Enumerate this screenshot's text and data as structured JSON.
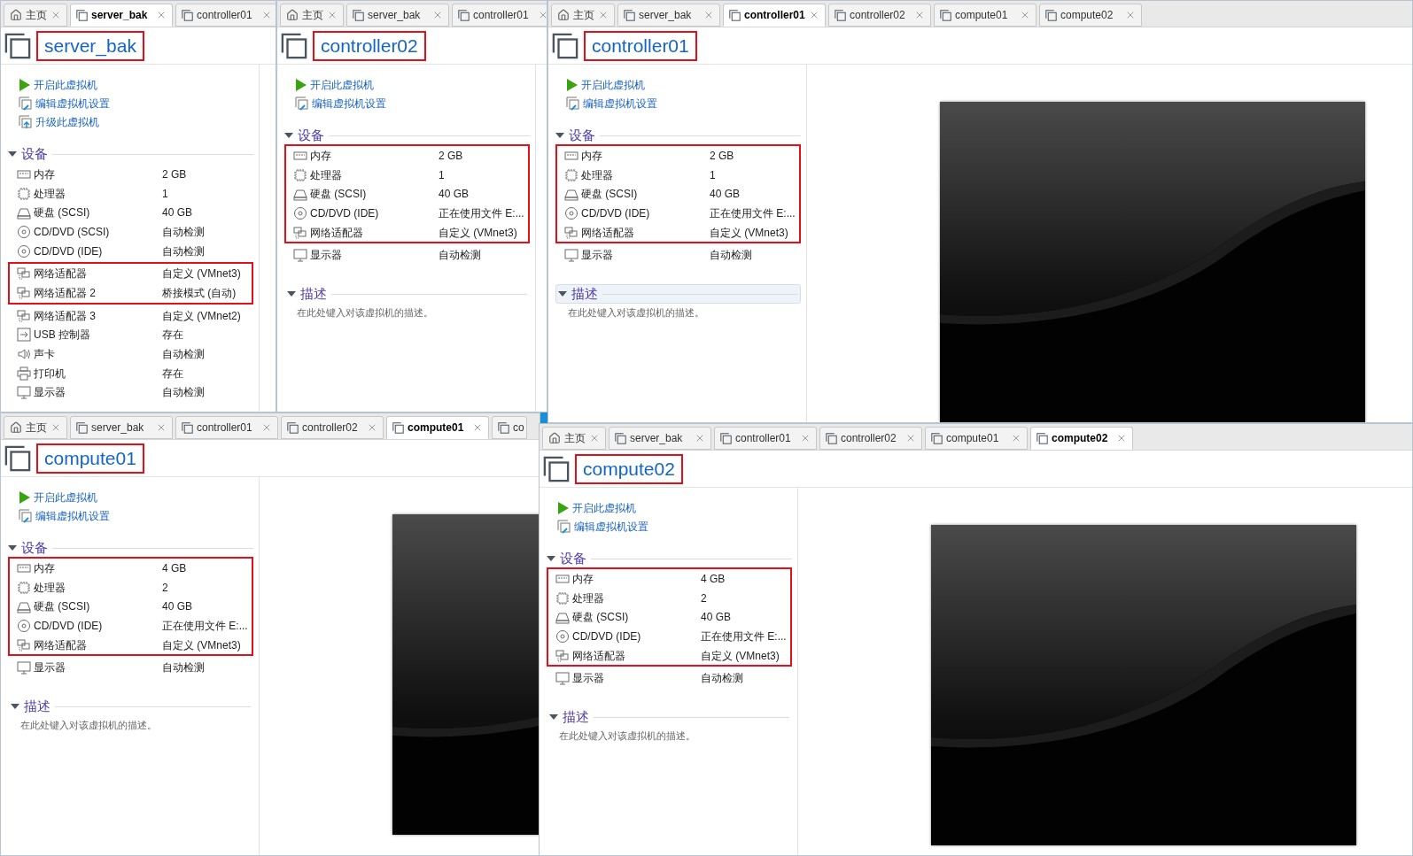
{
  "windows": [
    {
      "tabs": [
        {
          "label": "主页",
          "kind": "home",
          "selected": false
        },
        {
          "label": "server_bak",
          "kind": "vm",
          "selected": true
        },
        {
          "label": "controller01",
          "kind": "vm",
          "selected": false
        }
      ],
      "title": "server_bak",
      "title_highlighted": true,
      "actions": [
        {
          "label": "开启此虚拟机",
          "kind": "power"
        },
        {
          "label": "编辑虚拟机设置",
          "kind": "edit"
        },
        {
          "label": "升级此虚拟机",
          "kind": "upgrade"
        }
      ],
      "devices_header": "设备",
      "devices": [
        {
          "kind": "memory",
          "label": "内存",
          "value": "2 GB",
          "highlighted": false
        },
        {
          "kind": "cpu",
          "label": "处理器",
          "value": "1",
          "highlighted": false
        },
        {
          "kind": "disk",
          "label": "硬盘 (SCSI)",
          "value": "40 GB",
          "highlighted": false
        },
        {
          "kind": "cdrom",
          "label": "CD/DVD (SCSI)",
          "value": "自动检测",
          "highlighted": false
        },
        {
          "kind": "cdrom",
          "label": "CD/DVD (IDE)",
          "value": "自动检测",
          "highlighted": false
        },
        {
          "kind": "network",
          "label": "网络适配器",
          "value": "自定义 (VMnet3)",
          "highlighted": true
        },
        {
          "kind": "network",
          "label": "网络适配器 2",
          "value": "桥接模式 (自动)",
          "highlighted": true
        },
        {
          "kind": "network",
          "label": "网络适配器 3",
          "value": "自定义 (VMnet2)",
          "highlighted": false
        },
        {
          "kind": "usb",
          "label": "USB 控制器",
          "value": "存在",
          "highlighted": false
        },
        {
          "kind": "sound",
          "label": "声卡",
          "value": "自动检测",
          "highlighted": false
        },
        {
          "kind": "printer",
          "label": "打印机",
          "value": "存在",
          "highlighted": false
        },
        {
          "kind": "display",
          "label": "显示器",
          "value": "自动检测",
          "highlighted": false
        }
      ]
    },
    {
      "tabs": [
        {
          "label": "主页",
          "kind": "home",
          "selected": false
        },
        {
          "label": "server_bak",
          "kind": "vm",
          "selected": false
        },
        {
          "label": "controller01",
          "kind": "vm",
          "selected": false
        }
      ],
      "title": "controller02",
      "title_highlighted": true,
      "actions": [
        {
          "label": "开启此虚拟机",
          "kind": "power"
        },
        {
          "label": "编辑虚拟机设置",
          "kind": "edit"
        }
      ],
      "devices_header": "设备",
      "devices": [
        {
          "kind": "memory",
          "label": "内存",
          "value": "2 GB",
          "highlighted": true
        },
        {
          "kind": "cpu",
          "label": "处理器",
          "value": "1",
          "highlighted": true
        },
        {
          "kind": "disk",
          "label": "硬盘 (SCSI)",
          "value": "40 GB",
          "highlighted": true
        },
        {
          "kind": "cdrom",
          "label": "CD/DVD (IDE)",
          "value": "正在使用文件 E:...",
          "highlighted": true
        },
        {
          "kind": "network",
          "label": "网络适配器",
          "value": "自定义 (VMnet3)",
          "highlighted": true
        },
        {
          "kind": "display",
          "label": "显示器",
          "value": "自动检测",
          "highlighted": false
        }
      ],
      "description": {
        "label": "描述",
        "text": "在此处键入对该虚拟机的描述。",
        "selected": false
      }
    },
    {
      "tabs": [
        {
          "label": "主页",
          "kind": "home",
          "selected": false
        },
        {
          "label": "server_bak",
          "kind": "vm",
          "selected": false
        },
        {
          "label": "controller01",
          "kind": "vm",
          "selected": true
        },
        {
          "label": "controller02",
          "kind": "vm",
          "selected": false
        },
        {
          "label": "compute01",
          "kind": "vm",
          "selected": false
        },
        {
          "label": "compute02",
          "kind": "vm",
          "selected": false
        }
      ],
      "title": "controller01",
      "title_highlighted": true,
      "actions": [
        {
          "label": "开启此虚拟机",
          "kind": "power"
        },
        {
          "label": "编辑虚拟机设置",
          "kind": "edit"
        }
      ],
      "devices_header": "设备",
      "devices": [
        {
          "kind": "memory",
          "label": "内存",
          "value": "2 GB",
          "highlighted": true
        },
        {
          "kind": "cpu",
          "label": "处理器",
          "value": "1",
          "highlighted": true
        },
        {
          "kind": "disk",
          "label": "硬盘 (SCSI)",
          "value": "40 GB",
          "highlighted": true
        },
        {
          "kind": "cdrom",
          "label": "CD/DVD (IDE)",
          "value": "正在使用文件 E:...",
          "highlighted": true
        },
        {
          "kind": "network",
          "label": "网络适配器",
          "value": "自定义 (VMnet3)",
          "highlighted": true
        },
        {
          "kind": "display",
          "label": "显示器",
          "value": "自动检测",
          "highlighted": false
        }
      ],
      "description": {
        "label": "描述",
        "text": "在此处键入对该虚拟机的描述。",
        "selected": true
      },
      "preview": {
        "kind": "picture"
      }
    },
    {
      "tabs": [
        {
          "label": "主页",
          "kind": "home",
          "selected": false
        },
        {
          "label": "server_bak",
          "kind": "vm",
          "selected": false
        },
        {
          "label": "controller01",
          "kind": "vm",
          "selected": false
        },
        {
          "label": "controller02",
          "kind": "vm",
          "selected": false
        },
        {
          "label": "compute01",
          "kind": "vm",
          "selected": true
        },
        {
          "label": "co",
          "kind": "vm",
          "selected": false,
          "close_visible": false
        }
      ],
      "title": "compute01",
      "title_highlighted": true,
      "actions": [
        {
          "label": "开启此虚拟机",
          "kind": "power"
        },
        {
          "label": "编辑虚拟机设置",
          "kind": "edit"
        }
      ],
      "devices_header": "设备",
      "devices": [
        {
          "kind": "memory",
          "label": "内存",
          "value": "4 GB",
          "highlighted": true
        },
        {
          "kind": "cpu",
          "label": "处理器",
          "value": "2",
          "highlighted": true
        },
        {
          "kind": "disk",
          "label": "硬盘 (SCSI)",
          "value": "40 GB",
          "highlighted": true
        },
        {
          "kind": "cdrom",
          "label": "CD/DVD (IDE)",
          "value": "正在使用文件 E:...",
          "highlighted": true
        },
        {
          "kind": "network",
          "label": "网络适配器",
          "value": "自定义 (VMnet3)",
          "highlighted": true
        },
        {
          "kind": "display",
          "label": "显示器",
          "value": "自动检测",
          "highlighted": false
        }
      ],
      "description": {
        "label": "描述",
        "text": "在此处键入对该虚拟机的描述。",
        "selected": false
      },
      "preview": {
        "kind": "picture"
      }
    },
    {
      "tabs": [
        {
          "label": "主页",
          "kind": "home",
          "selected": false
        },
        {
          "label": "server_bak",
          "kind": "vm",
          "selected": false
        },
        {
          "label": "controller01",
          "kind": "vm",
          "selected": false
        },
        {
          "label": "controller02",
          "kind": "vm",
          "selected": false
        },
        {
          "label": "compute01",
          "kind": "vm",
          "selected": false
        },
        {
          "label": "compute02",
          "kind": "vm",
          "selected": true
        }
      ],
      "title": "compute02",
      "title_highlighted": true,
      "actions": [
        {
          "label": "开启此虚拟机",
          "kind": "power"
        },
        {
          "label": "编辑虚拟机设置",
          "kind": "edit"
        }
      ],
      "devices_header": "设备",
      "devices": [
        {
          "kind": "memory",
          "label": "内存",
          "value": "4 GB",
          "highlighted": true
        },
        {
          "kind": "cpu",
          "label": "处理器",
          "value": "2",
          "highlighted": true
        },
        {
          "kind": "disk",
          "label": "硬盘 (SCSI)",
          "value": "40 GB",
          "highlighted": true
        },
        {
          "kind": "cdrom",
          "label": "CD/DVD (IDE)",
          "value": "正在使用文件 E:...",
          "highlighted": true
        },
        {
          "kind": "network",
          "label": "网络适配器",
          "value": "自定义 (VMnet3)",
          "highlighted": true
        },
        {
          "kind": "display",
          "label": "显示器",
          "value": "自动检测",
          "highlighted": false
        }
      ],
      "description": {
        "label": "描述",
        "text": "在此处键入对该虚拟机的描述。",
        "selected": false
      },
      "preview": {
        "kind": "picture"
      }
    }
  ]
}
